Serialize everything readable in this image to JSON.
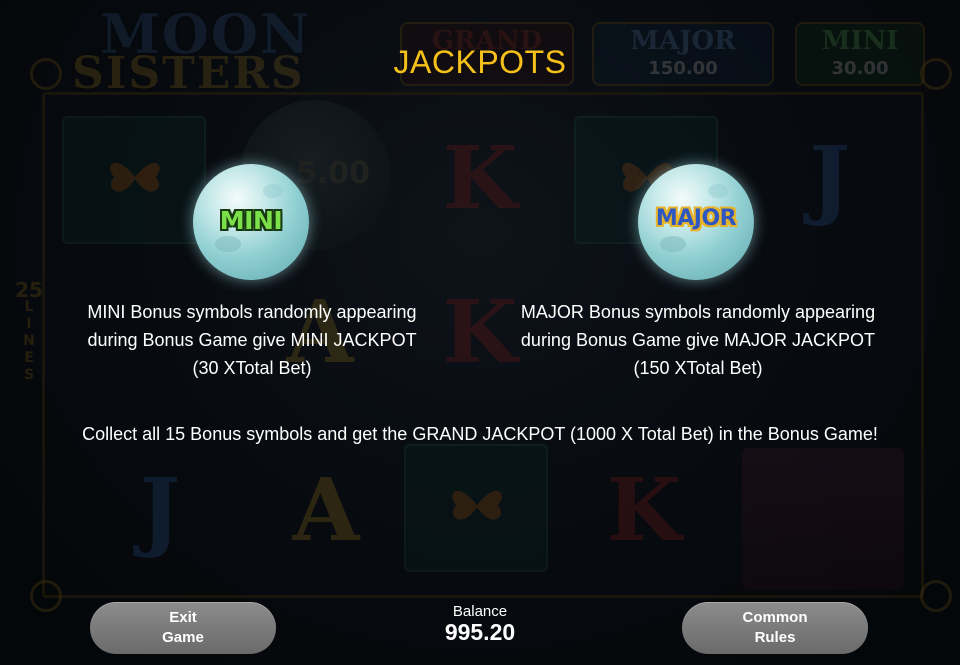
{
  "background": {
    "logo": {
      "line1": "MOON",
      "line2": "SISTERS"
    },
    "jackpot_meters": [
      {
        "name": "GRAND",
        "value": ""
      },
      {
        "name": "MAJOR",
        "value": "150.00"
      },
      {
        "name": "MINI",
        "value": "30.00"
      }
    ],
    "moon_value": "5.00",
    "lines": {
      "count": "25",
      "label": "LINES"
    },
    "reel_letters": [
      "K",
      "J",
      "A",
      "K",
      "J",
      "A",
      "K"
    ]
  },
  "dialog": {
    "title": "JACKPOTS",
    "mini": {
      "icon_label": "MINI",
      "line1": "MINI Bonus symbols randomly appearing",
      "line2": "during Bonus Game give MINI JACKPOT",
      "line3": "(30 XTotal Bet)"
    },
    "major": {
      "icon_label": "MAJOR",
      "line1": "MAJOR Bonus symbols randomly appearing",
      "line2": "during Bonus Game give MAJOR JACKPOT",
      "line3": "(150 XTotal Bet)"
    },
    "grand_text": "Collect all 15 Bonus symbols and get the GRAND JACKPOT (1000 X Total Bet) in the Bonus Game!"
  },
  "bottom_bar": {
    "exit_line1": "Exit",
    "exit_line2": "Game",
    "balance_label": "Balance",
    "balance_value": "995.20",
    "rules_line1": "Common",
    "rules_line2": "Rules"
  },
  "colors": {
    "title": "#f6c01a",
    "button": "#7a7a7a",
    "text": "#ffffff"
  }
}
